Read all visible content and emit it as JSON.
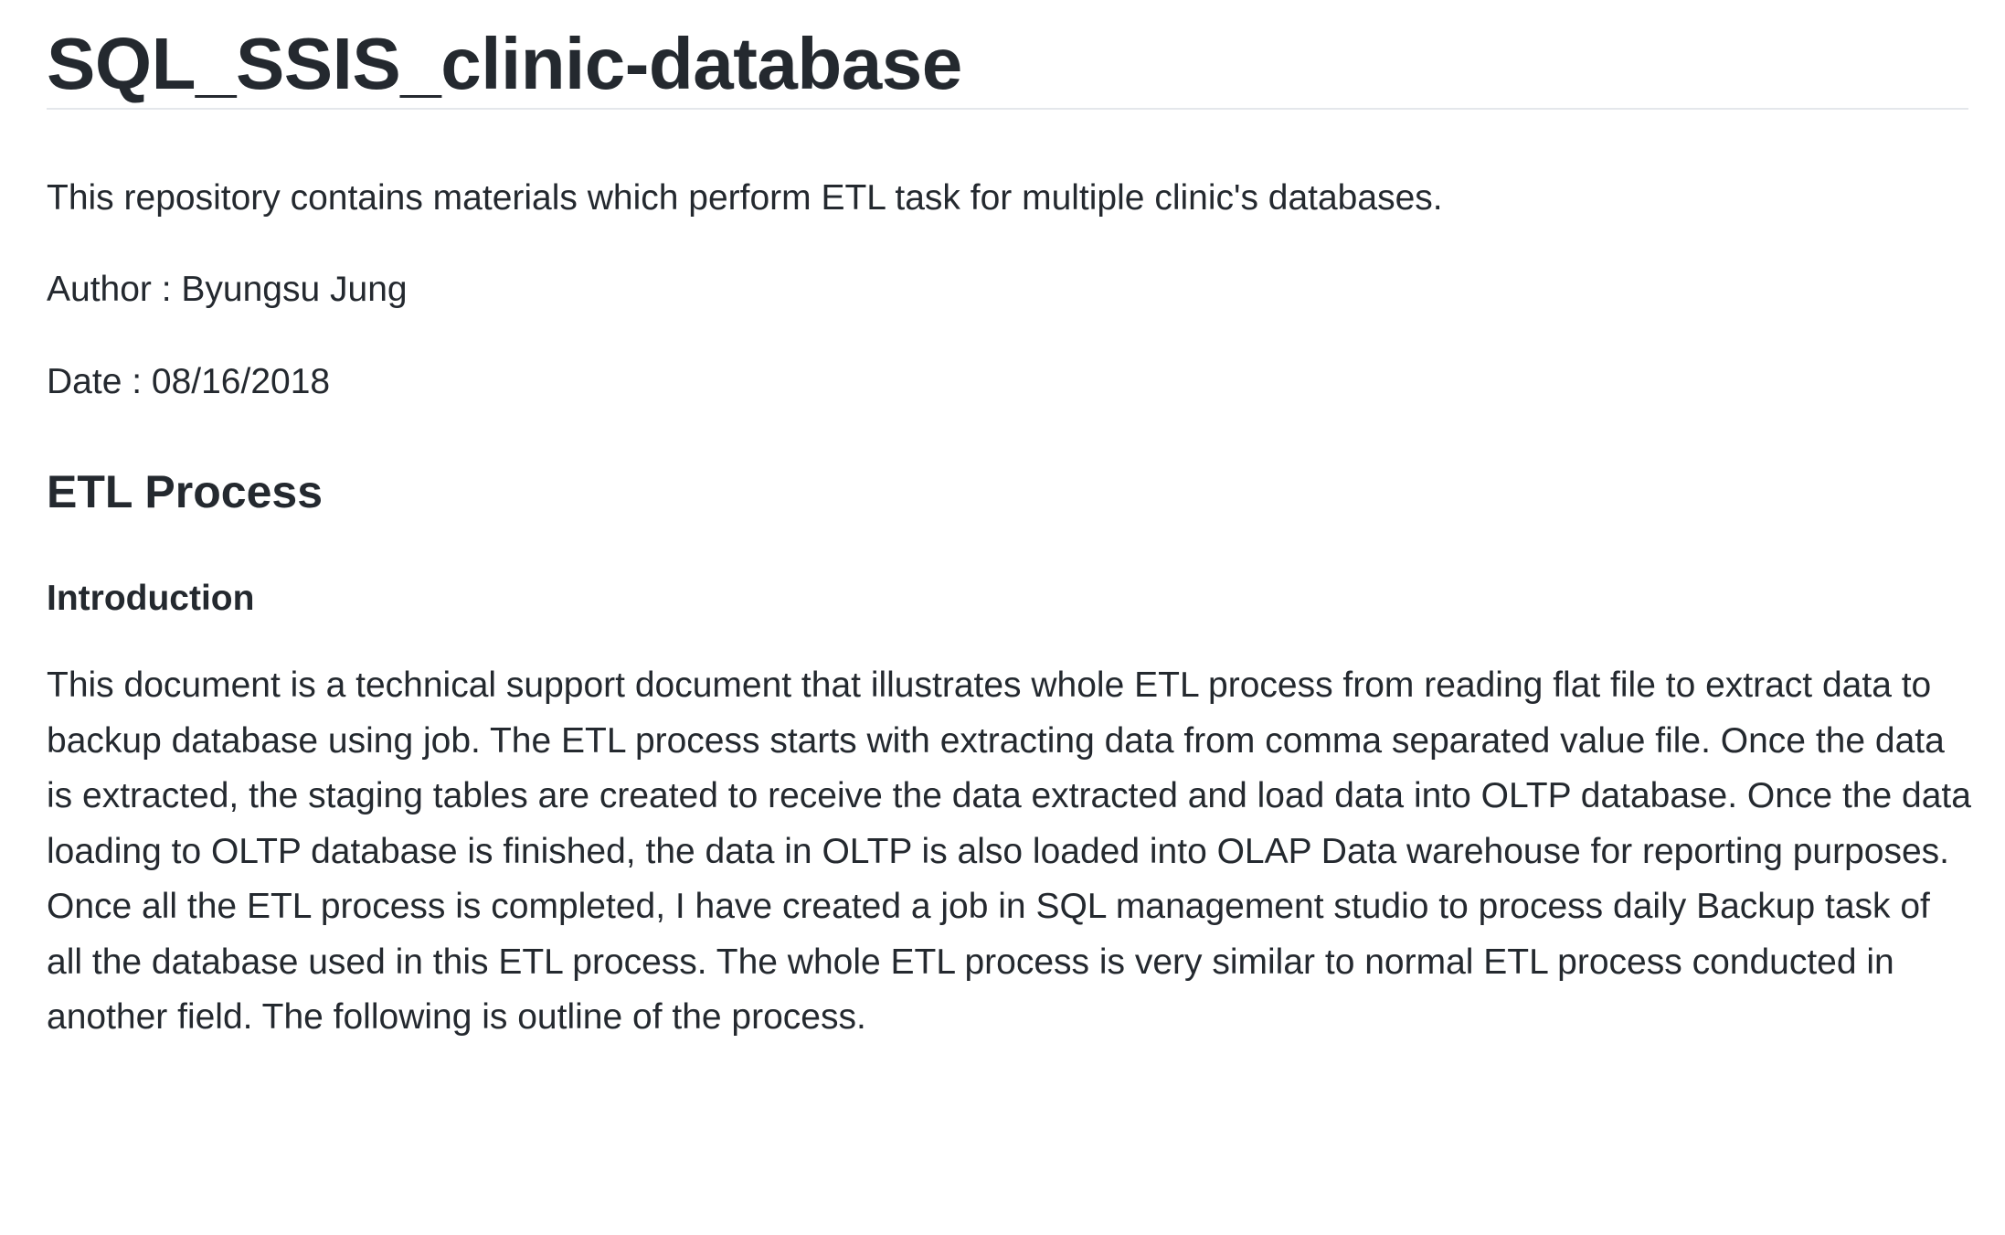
{
  "title": "SQL_SSIS_clinic-database",
  "description": "This repository contains materials which perform ETL task for multiple clinic's databases.",
  "author_line": "Author : Byungsu Jung",
  "date_line": "Date : 08/16/2018",
  "section_heading": "ETL Process",
  "subsection_heading": "Introduction",
  "intro_paragraph": "This document is a technical support document that illustrates whole ETL process from reading flat file to extract data to backup database using job. The ETL process starts with extracting data from comma separated value file. Once the data is extracted, the staging tables are created to receive the data extracted and load data into OLTP database. Once the data loading to OLTP database is finished, the data in OLTP is also loaded into OLAP Data warehouse for reporting purposes. Once all the ETL process is completed, I have created a job in SQL management studio to process daily Backup task of all the database used in this ETL process. The whole ETL process is very similar to normal ETL process conducted in another field. The following is outline of the process."
}
